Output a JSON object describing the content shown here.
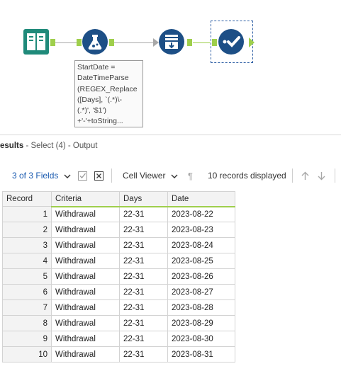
{
  "workflow": {
    "annotation_text": "StartDate =\nDateTimeParse\n(REGEX_Replace\n([Days], `(.*)\\-\n(.*)', '$1')\n+'-'+toString..."
  },
  "results": {
    "title": "esults",
    "subtitle": " - Select (4) - Output",
    "fields_selector": "3 of 3 Fields",
    "viewer_label": "Cell Viewer",
    "records_displayed": "10 records displayed",
    "columns": [
      "Record",
      "Criteria",
      "Days",
      "Date"
    ],
    "rows": [
      {
        "record": "1",
        "criteria": "Withdrawal",
        "days": "22-31",
        "date": "2023-08-22"
      },
      {
        "record": "2",
        "criteria": "Withdrawal",
        "days": "22-31",
        "date": "2023-08-23"
      },
      {
        "record": "3",
        "criteria": "Withdrawal",
        "days": "22-31",
        "date": "2023-08-24"
      },
      {
        "record": "4",
        "criteria": "Withdrawal",
        "days": "22-31",
        "date": "2023-08-25"
      },
      {
        "record": "5",
        "criteria": "Withdrawal",
        "days": "22-31",
        "date": "2023-08-26"
      },
      {
        "record": "6",
        "criteria": "Withdrawal",
        "days": "22-31",
        "date": "2023-08-27"
      },
      {
        "record": "7",
        "criteria": "Withdrawal",
        "days": "22-31",
        "date": "2023-08-28"
      },
      {
        "record": "8",
        "criteria": "Withdrawal",
        "days": "22-31",
        "date": "2023-08-29"
      },
      {
        "record": "9",
        "criteria": "Withdrawal",
        "days": "22-31",
        "date": "2023-08-30"
      },
      {
        "record": "10",
        "criteria": "Withdrawal",
        "days": "22-31",
        "date": "2023-08-31"
      }
    ]
  },
  "colors": {
    "anchor_green": "#9fcf4c",
    "tool_teal": "#1f8a7a",
    "tool_blue": "#1d4f86",
    "link_blue": "#1b5bb0"
  },
  "icons": [
    "input-book-icon",
    "formula-flask-icon",
    "sort-arrange-icon",
    "select-check-icon",
    "chevron-down-icon",
    "checkbox-icon",
    "close-box-icon",
    "pilcrow-icon",
    "arrow-up-icon",
    "arrow-down-icon"
  ]
}
